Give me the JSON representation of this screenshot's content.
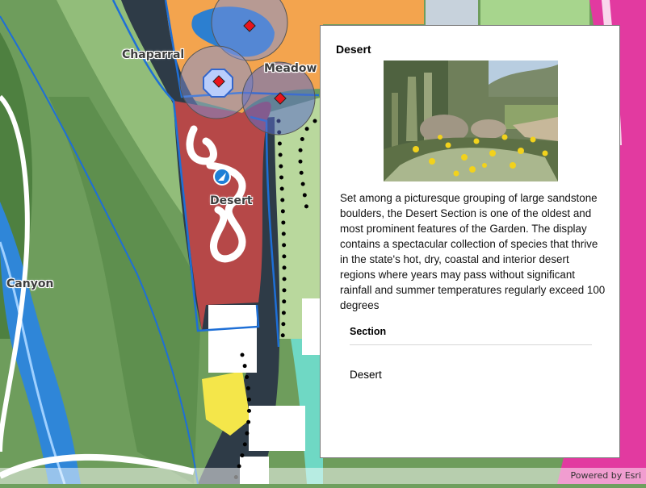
{
  "map": {
    "labels": {
      "chaparral": "Chaparral",
      "meadow": "Meadow",
      "desert": "Desert",
      "canyon": "Canyon"
    },
    "colors": {
      "forest": "#5f8f4c",
      "meadow_green": "#a9cf8f",
      "chaparral_orange": "#f3a44e",
      "desert_red": "#b64848",
      "path_dark": "#2e3b47",
      "boundary_blue": "#1e6fd6",
      "canyon_water": "#2f86d8",
      "pink_area": "#e23aa0",
      "selection_fill": "#7b8fd8"
    },
    "markers": [
      "diamond-marker",
      "diamond-marker",
      "diamond-marker",
      "diamond-marker"
    ]
  },
  "popup": {
    "title": "Desert",
    "description": "Set among a picturesque grouping of large sandstone boulders, the Desert Section is one of the oldest and most prominent features of the Garden. The display contains a spectacular collection of species that thrive in the state's hot, dry, coastal and interior desert regions where years may pass without significant rainfall and summer temperatures regularly exceed 100 degrees",
    "fields": [
      {
        "name": "Section",
        "value": "Desert"
      }
    ]
  },
  "attribution": "Powered by Esri"
}
